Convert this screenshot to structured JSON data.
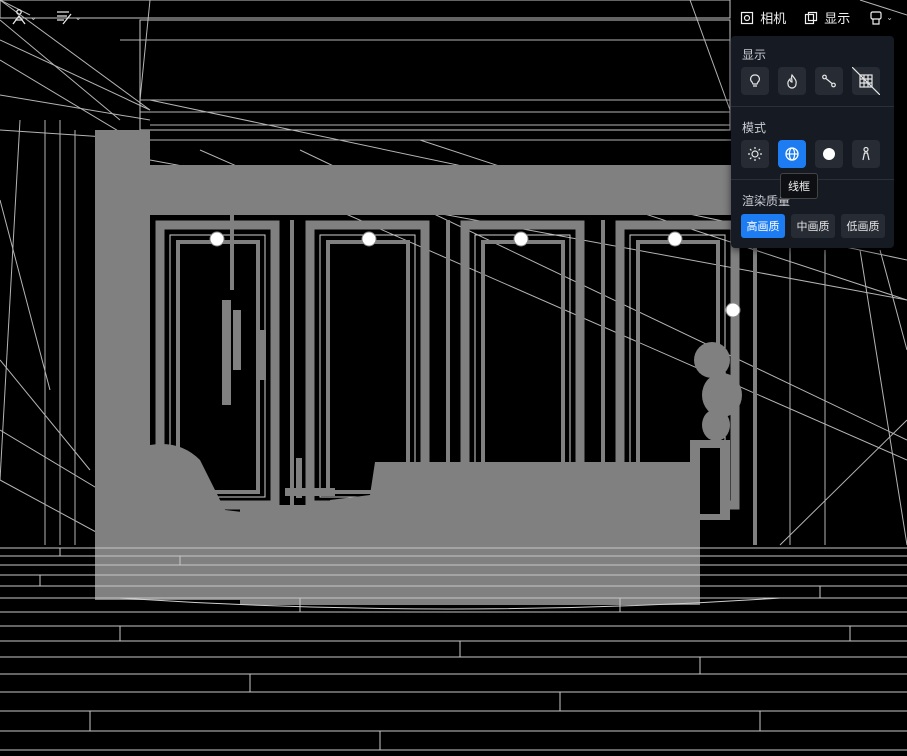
{
  "toolbar": {
    "camera_label": "相机",
    "display_label": "显示"
  },
  "panel": {
    "display_title": "显示",
    "mode_title": "模式",
    "quality_title": "渲染质量",
    "tooltip": "线框",
    "quality_options": [
      "高画质",
      "中画质",
      "低画质"
    ],
    "selected_quality": "高画质",
    "active_mode": "wireframe"
  },
  "colors": {
    "accent": "#1e7cf2",
    "panel_bg": "#161a22",
    "wire": "#b8b8b8",
    "solid": "#808080"
  }
}
